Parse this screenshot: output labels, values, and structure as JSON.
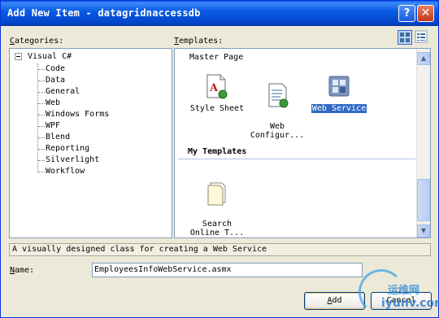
{
  "dialog": {
    "title": "Add New Item - datagridnaccessdb",
    "help_glyph": "?",
    "close_glyph": "✕"
  },
  "categories": {
    "label_underlined": "C",
    "label_rest": "ategories:",
    "root": "Visual C#",
    "items": [
      "Code",
      "Data",
      "General",
      "Web",
      "Windows Forms",
      "WPF",
      "Blend",
      "Reporting",
      "Silverlight",
      "Workflow"
    ]
  },
  "templates": {
    "label_underlined": "T",
    "label_rest": "emplates:",
    "partial_header": "Master Page",
    "items": [
      {
        "label": "Style Sheet"
      },
      {
        "label": "Web\nConfigur..."
      },
      {
        "label": "Web Service",
        "selected": true
      }
    ],
    "my_templates_header": "My Templates",
    "my_items": [
      {
        "label": "Search\nOnline T..."
      }
    ]
  },
  "description": "A visually designed class for creating a Web Service",
  "name_field": {
    "label_underlined": "N",
    "label_rest": "ame:",
    "value": "EmployeesInfoWebService.asmx"
  },
  "buttons": {
    "add_underlined": "A",
    "add_rest": "dd",
    "cancel": "Cancel"
  },
  "scroll_arrows": {
    "up": "▲",
    "down": "▼"
  },
  "watermark": {
    "line1": "运维网",
    "line2": "iyunv.com"
  },
  "colors": {
    "accent": "#316ac5",
    "titlebar": "#0a5ce6"
  },
  "view_toggle_icons": [
    "large-icons-icon",
    "small-icons-icon"
  ]
}
